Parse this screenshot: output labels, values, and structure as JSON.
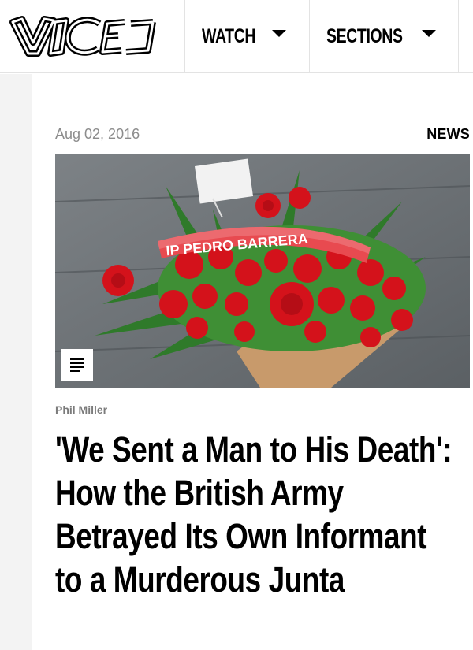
{
  "header": {
    "logo_text": "VICE",
    "nav": [
      {
        "label": "WATCH"
      },
      {
        "label": "SECTIONS"
      }
    ]
  },
  "article": {
    "date": "Aug 02, 2016",
    "category": "NEWS",
    "image": {
      "banner_text": "IP PEDRO BARRERA",
      "badge_icon": "article-lines-icon"
    },
    "author": "Phil Miller",
    "title": "'We Sent a Man to His Death': How the British Army Betrayed Its Own Informant to a Murderous Junta"
  },
  "colors": {
    "rule": "#e3e3e3",
    "gutter": "#f3f3f3",
    "meta": "#8c8c8c",
    "author": "#7b7b7b",
    "flower_red": "#d4121b"
  }
}
